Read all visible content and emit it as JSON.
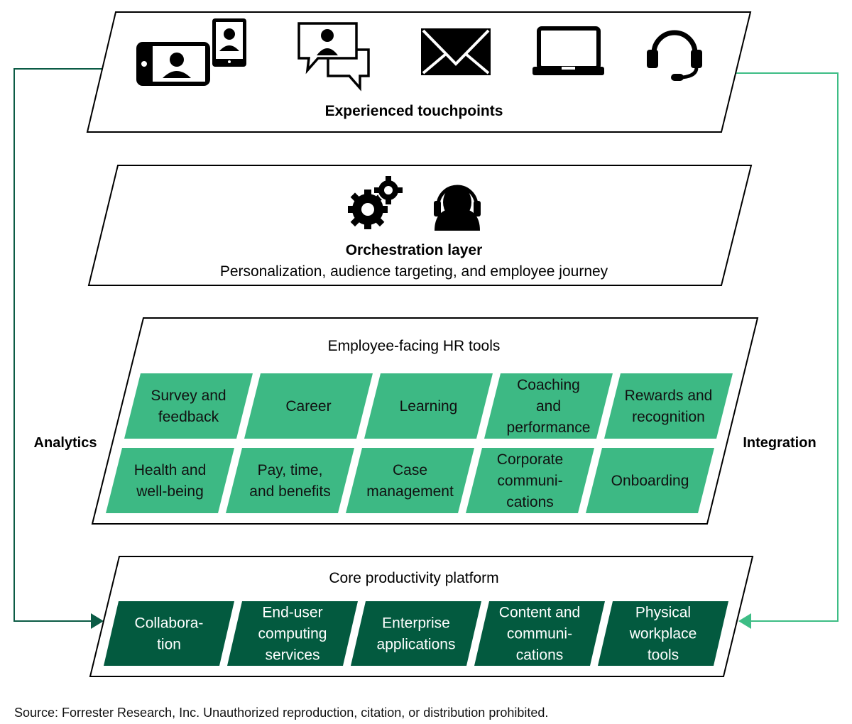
{
  "colors": {
    "light_green": "#3DB984",
    "dark_green": "#035A3F",
    "outline": "#000000",
    "analytics_line": "#0B5B45",
    "integration_line": "#3DBD85"
  },
  "layers": {
    "touchpoints": {
      "title": "Experienced touchpoints",
      "icons": [
        "video-call-devices-icon",
        "chat-bubbles-icon",
        "email-envelope-icon",
        "laptop-icon",
        "headset-icon"
      ]
    },
    "orchestration": {
      "title": "Orchestration layer",
      "subtitle": "Personalization, audience targeting, and employee journey",
      "icons": [
        "gears-icon",
        "agent-with-headset-icon"
      ]
    },
    "hr_tools": {
      "heading": "Employee-facing HR tools",
      "row1": [
        {
          "lines": [
            "Survey and",
            "feedback"
          ]
        },
        {
          "lines": [
            "Career"
          ]
        },
        {
          "lines": [
            "Learning"
          ]
        },
        {
          "lines": [
            "Coaching",
            "and",
            "performance"
          ]
        },
        {
          "lines": [
            "Rewards and",
            "recognition"
          ]
        }
      ],
      "row2": [
        {
          "lines": [
            "Health and",
            "well-being"
          ]
        },
        {
          "lines": [
            "Pay, time,",
            "and benefits"
          ]
        },
        {
          "lines": [
            "Case",
            "management"
          ]
        },
        {
          "lines": [
            "Corporate",
            "communi-",
            "cations"
          ]
        },
        {
          "lines": [
            "Onboarding"
          ]
        }
      ]
    },
    "core_platform": {
      "heading": "Core productivity platform",
      "tiles": [
        {
          "lines": [
            "Collabora-",
            "tion"
          ]
        },
        {
          "lines": [
            "End-user",
            "computing",
            "services"
          ]
        },
        {
          "lines": [
            "Enterprise",
            "applications"
          ]
        },
        {
          "lines": [
            "Content and",
            "communi-",
            "cations"
          ]
        },
        {
          "lines": [
            "Physical",
            "workplace",
            "tools"
          ]
        }
      ]
    }
  },
  "side_labels": {
    "left": "Analytics",
    "right": "Integration"
  },
  "source": "Source: Forrester Research, Inc. Unauthorized reproduction, citation, or distribution prohibited."
}
